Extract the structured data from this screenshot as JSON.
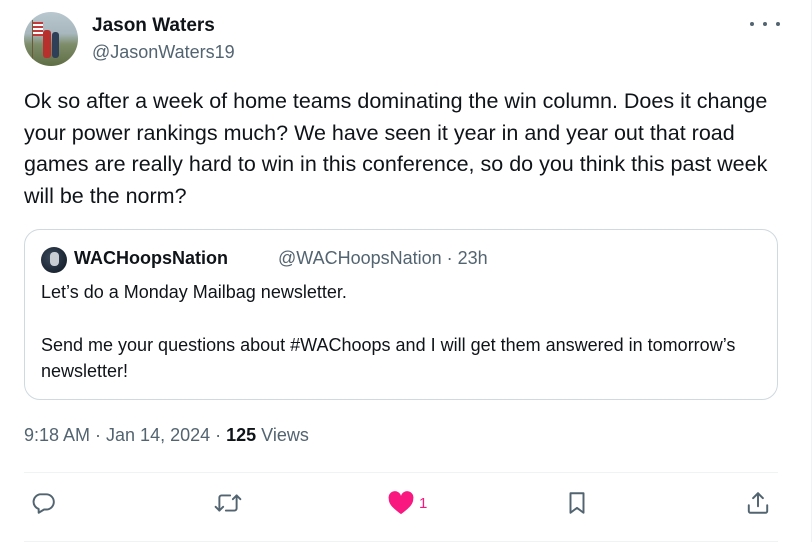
{
  "author": {
    "name": "Jason Waters",
    "handle": "@JasonWaters19"
  },
  "tweet": {
    "text": "Ok so after a week of home teams dominating  the win column. Does it change your power rankings much? We have seen it year in and year out that road games are really  hard to win in this conference, so do you think this past week will be the norm?"
  },
  "quote": {
    "name": "WACHoopsNation",
    "meta": "@WACHoopsNation · 23h",
    "line1": "Let’s do a Monday Mailbag newsletter.",
    "line2": "Send me your questions about #WAChoops and I will get them answered in tomorrow’s newsletter!"
  },
  "meta": {
    "timestamp": "9:18 AM · Jan 14, 2024 · ",
    "views_count": "125",
    "views_label": " Views"
  },
  "actions": {
    "like_count": "1"
  },
  "icons": {
    "more": "more-horizontal-icon",
    "reply": "reply-icon",
    "retweet": "retweet-icon",
    "like": "heart-icon",
    "bookmark": "bookmark-icon",
    "share": "share-icon"
  },
  "colors": {
    "like_active": "#f91880",
    "secondary_text": "#536471",
    "border": "#cfd9de"
  }
}
